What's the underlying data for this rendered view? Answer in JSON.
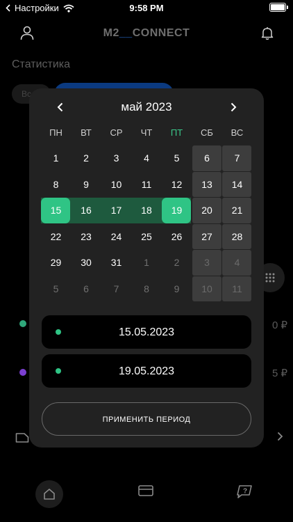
{
  "status_bar": {
    "carrier": "Настройки",
    "time": "9:58 PM",
    "icons": [
      "back-arrow-icon",
      "wifi-icon",
      "battery-icon"
    ]
  },
  "header": {
    "logo_left": "M2",
    "logo_right": "CONNECT",
    "icons": [
      "user-icon",
      "bell-icon"
    ]
  },
  "background": {
    "section_title": "Статистика",
    "chip_label": "Вс",
    "amount_1": "0 ₽",
    "amount_2": "5 ₽",
    "dot_colors": [
      "#2fa77a",
      "#7b3fd1"
    ]
  },
  "calendar": {
    "month_label": "май 2023",
    "prev_icon": "chevron-left-icon",
    "next_icon": "chevron-right-icon",
    "weekdays": [
      "ПН",
      "ВТ",
      "СР",
      "ЧТ",
      "ПТ",
      "СБ",
      "ВС"
    ],
    "highlighted_weekday_index": 4,
    "weeks": [
      [
        "1",
        "2",
        "3",
        "4",
        "5",
        "6",
        "7"
      ],
      [
        "8",
        "9",
        "10",
        "11",
        "12",
        "13",
        "14"
      ],
      [
        "15",
        "16",
        "17",
        "18",
        "19",
        "20",
        "21"
      ],
      [
        "22",
        "23",
        "24",
        "25",
        "26",
        "27",
        "28"
      ],
      [
        "29",
        "30",
        "31",
        "1",
        "2",
        "3",
        "4"
      ],
      [
        "5",
        "6",
        "7",
        "8",
        "9",
        "10",
        "11"
      ]
    ],
    "range_start": "15",
    "range_end": "19",
    "accent_color": "#2fc485"
  },
  "period": {
    "start_date": "15.05.2023",
    "end_date": "19.05.2023",
    "apply_label": "ПРИМЕНИТЬ ПЕРИОД"
  },
  "tabbar": {
    "icons": [
      "home-icon",
      "card-icon",
      "help-icon"
    ]
  }
}
